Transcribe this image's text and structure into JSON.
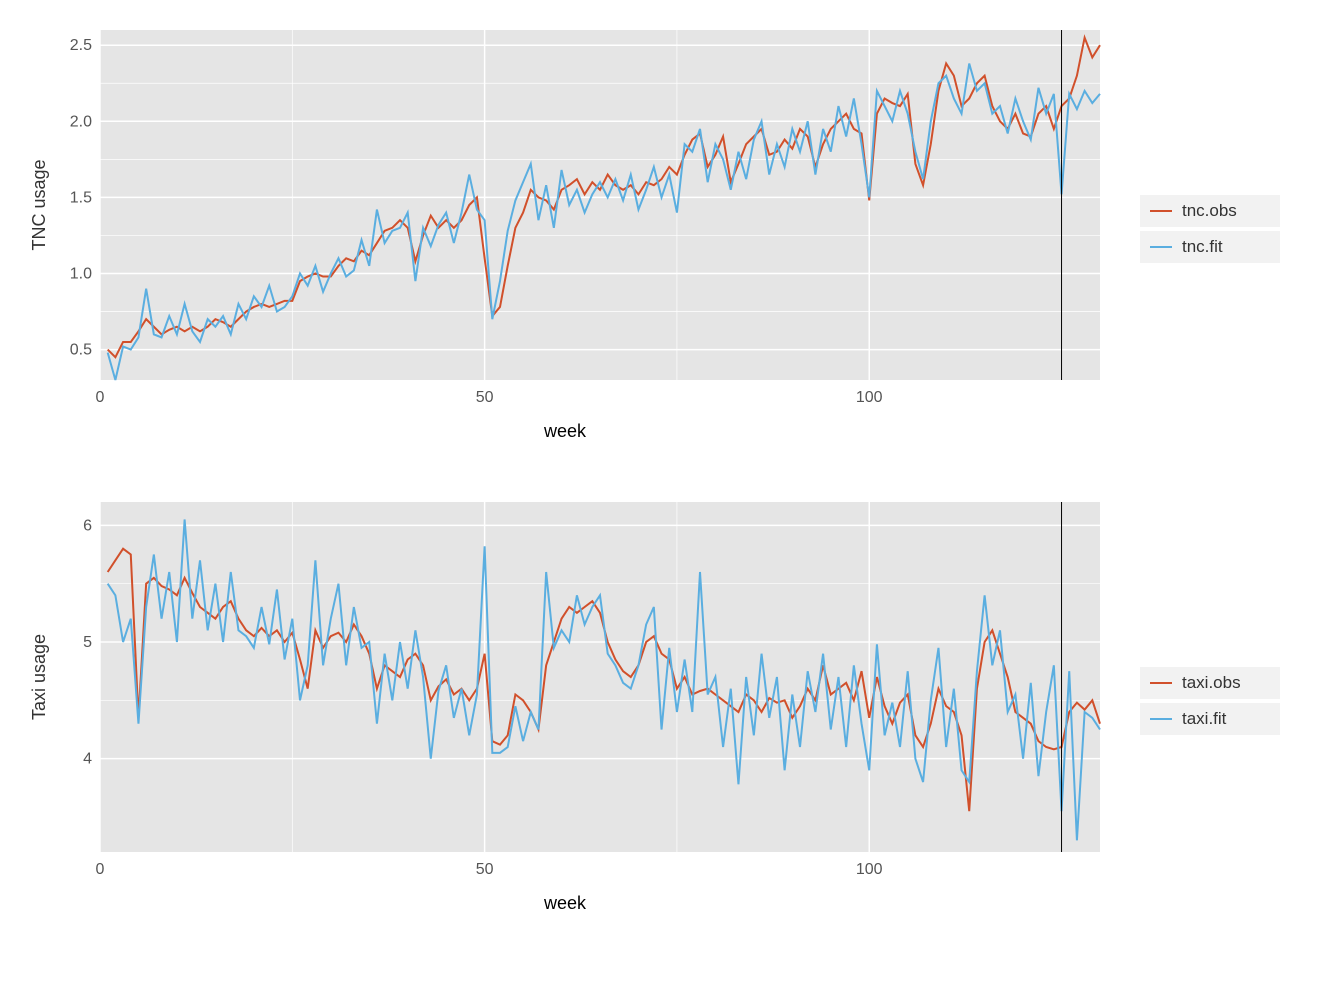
{
  "chart_data": [
    {
      "type": "line",
      "xlabel": "week",
      "ylabel": "TNC usage",
      "xlim": [
        0,
        130
      ],
      "ylim": [
        0.3,
        2.6
      ],
      "x_ticks": [
        0,
        50,
        100
      ],
      "y_ticks": [
        0.5,
        1.0,
        1.5,
        2.0,
        2.5
      ],
      "vline_x": 125,
      "series": [
        {
          "name": "tnc.obs",
          "color": "#d1502b",
          "x": [
            1,
            2,
            3,
            4,
            5,
            6,
            7,
            8,
            9,
            10,
            11,
            12,
            13,
            14,
            15,
            16,
            17,
            18,
            19,
            20,
            21,
            22,
            23,
            24,
            25,
            26,
            27,
            28,
            29,
            30,
            31,
            32,
            33,
            34,
            35,
            36,
            37,
            38,
            39,
            40,
            41,
            42,
            43,
            44,
            45,
            46,
            47,
            48,
            49,
            50,
            51,
            52,
            53,
            54,
            55,
            56,
            57,
            58,
            59,
            60,
            61,
            62,
            63,
            64,
            65,
            66,
            67,
            68,
            69,
            70,
            71,
            72,
            73,
            74,
            75,
            76,
            77,
            78,
            79,
            80,
            81,
            82,
            83,
            84,
            85,
            86,
            87,
            88,
            89,
            90,
            91,
            92,
            93,
            94,
            95,
            96,
            97,
            98,
            99,
            100,
            101,
            102,
            103,
            104,
            105,
            106,
            107,
            108,
            109,
            110,
            111,
            112,
            113,
            114,
            115,
            116,
            117,
            118,
            119,
            120,
            121,
            122,
            123,
            124,
            125,
            126,
            127,
            128,
            129,
            130
          ],
          "y": [
            0.5,
            0.45,
            0.55,
            0.55,
            0.62,
            0.7,
            0.65,
            0.6,
            0.63,
            0.65,
            0.62,
            0.65,
            0.62,
            0.65,
            0.7,
            0.68,
            0.65,
            0.7,
            0.75,
            0.78,
            0.8,
            0.78,
            0.8,
            0.82,
            0.82,
            0.95,
            0.98,
            1.0,
            0.98,
            0.98,
            1.05,
            1.1,
            1.08,
            1.15,
            1.12,
            1.2,
            1.28,
            1.3,
            1.35,
            1.3,
            1.08,
            1.25,
            1.38,
            1.3,
            1.35,
            1.3,
            1.35,
            1.45,
            1.5,
            1.1,
            0.72,
            0.78,
            1.05,
            1.3,
            1.4,
            1.55,
            1.5,
            1.48,
            1.42,
            1.55,
            1.58,
            1.62,
            1.52,
            1.6,
            1.55,
            1.65,
            1.58,
            1.55,
            1.58,
            1.52,
            1.6,
            1.58,
            1.62,
            1.7,
            1.65,
            1.78,
            1.88,
            1.92,
            1.7,
            1.78,
            1.9,
            1.6,
            1.72,
            1.85,
            1.9,
            1.95,
            1.78,
            1.8,
            1.88,
            1.82,
            1.95,
            1.9,
            1.7,
            1.85,
            1.95,
            2.0,
            2.05,
            1.95,
            1.92,
            1.48,
            2.05,
            2.15,
            2.12,
            2.1,
            2.18,
            1.72,
            1.58,
            1.85,
            2.2,
            2.38,
            2.3,
            2.1,
            2.15,
            2.25,
            2.3,
            2.1,
            2.0,
            1.95,
            2.05,
            1.92,
            1.9,
            2.05,
            2.1,
            1.95,
            2.1,
            2.15,
            2.3,
            2.55,
            2.42,
            2.5
          ]
        },
        {
          "name": "tnc.fit",
          "color": "#5aaee0",
          "x": [
            1,
            2,
            3,
            4,
            5,
            6,
            7,
            8,
            9,
            10,
            11,
            12,
            13,
            14,
            15,
            16,
            17,
            18,
            19,
            20,
            21,
            22,
            23,
            24,
            25,
            26,
            27,
            28,
            29,
            30,
            31,
            32,
            33,
            34,
            35,
            36,
            37,
            38,
            39,
            40,
            41,
            42,
            43,
            44,
            45,
            46,
            47,
            48,
            49,
            50,
            51,
            52,
            53,
            54,
            55,
            56,
            57,
            58,
            59,
            60,
            61,
            62,
            63,
            64,
            65,
            66,
            67,
            68,
            69,
            70,
            71,
            72,
            73,
            74,
            75,
            76,
            77,
            78,
            79,
            80,
            81,
            82,
            83,
            84,
            85,
            86,
            87,
            88,
            89,
            90,
            91,
            92,
            93,
            94,
            95,
            96,
            97,
            98,
            99,
            100,
            101,
            102,
            103,
            104,
            105,
            106,
            107,
            108,
            109,
            110,
            111,
            112,
            113,
            114,
            115,
            116,
            117,
            118,
            119,
            120,
            121,
            122,
            123,
            124,
            125,
            126,
            127,
            128,
            129,
            130
          ],
          "y": [
            0.48,
            0.3,
            0.52,
            0.5,
            0.58,
            0.9,
            0.6,
            0.58,
            0.72,
            0.6,
            0.8,
            0.62,
            0.55,
            0.7,
            0.65,
            0.72,
            0.6,
            0.8,
            0.7,
            0.85,
            0.78,
            0.92,
            0.75,
            0.78,
            0.85,
            1.0,
            0.92,
            1.05,
            0.88,
            1.0,
            1.1,
            0.98,
            1.02,
            1.22,
            1.05,
            1.42,
            1.2,
            1.28,
            1.3,
            1.4,
            0.95,
            1.3,
            1.18,
            1.32,
            1.4,
            1.2,
            1.4,
            1.65,
            1.42,
            1.35,
            0.7,
            0.95,
            1.28,
            1.48,
            1.6,
            1.72,
            1.35,
            1.58,
            1.3,
            1.68,
            1.45,
            1.55,
            1.4,
            1.52,
            1.6,
            1.5,
            1.62,
            1.48,
            1.65,
            1.42,
            1.55,
            1.7,
            1.5,
            1.65,
            1.4,
            1.85,
            1.8,
            1.95,
            1.6,
            1.85,
            1.75,
            1.55,
            1.8,
            1.62,
            1.88,
            2.0,
            1.65,
            1.85,
            1.7,
            1.95,
            1.8,
            2.0,
            1.65,
            1.95,
            1.8,
            2.1,
            1.9,
            2.15,
            1.85,
            1.5,
            2.2,
            2.1,
            2.0,
            2.2,
            2.05,
            1.8,
            1.62,
            2.0,
            2.25,
            2.3,
            2.15,
            2.05,
            2.38,
            2.2,
            2.25,
            2.05,
            2.1,
            1.92,
            2.15,
            2.0,
            1.88,
            2.22,
            2.05,
            2.18,
            1.52,
            2.18,
            2.08,
            2.2,
            2.12,
            2.18
          ]
        }
      ],
      "legend": [
        "tnc.obs",
        "tnc.fit"
      ]
    },
    {
      "type": "line",
      "xlabel": "week",
      "ylabel": "Taxi usage",
      "xlim": [
        0,
        130
      ],
      "ylim": [
        3.2,
        6.2
      ],
      "x_ticks": [
        0,
        50,
        100
      ],
      "y_ticks": [
        4,
        5,
        6
      ],
      "vline_x": 125,
      "series": [
        {
          "name": "taxi.obs",
          "color": "#d1502b",
          "x": [
            1,
            2,
            3,
            4,
            5,
            6,
            7,
            8,
            9,
            10,
            11,
            12,
            13,
            14,
            15,
            16,
            17,
            18,
            19,
            20,
            21,
            22,
            23,
            24,
            25,
            26,
            27,
            28,
            29,
            30,
            31,
            32,
            33,
            34,
            35,
            36,
            37,
            38,
            39,
            40,
            41,
            42,
            43,
            44,
            45,
            46,
            47,
            48,
            49,
            50,
            51,
            52,
            53,
            54,
            55,
            56,
            57,
            58,
            59,
            60,
            61,
            62,
            63,
            64,
            65,
            66,
            67,
            68,
            69,
            70,
            71,
            72,
            73,
            74,
            75,
            76,
            77,
            78,
            79,
            80,
            81,
            82,
            83,
            84,
            85,
            86,
            87,
            88,
            89,
            90,
            91,
            92,
            93,
            94,
            95,
            96,
            97,
            98,
            99,
            100,
            101,
            102,
            103,
            104,
            105,
            106,
            107,
            108,
            109,
            110,
            111,
            112,
            113,
            114,
            115,
            116,
            117,
            118,
            119,
            120,
            121,
            122,
            123,
            124,
            125,
            126,
            127,
            128,
            129,
            130
          ],
          "y": [
            5.6,
            5.7,
            5.8,
            5.75,
            4.35,
            5.5,
            5.55,
            5.48,
            5.45,
            5.4,
            5.55,
            5.42,
            5.3,
            5.25,
            5.2,
            5.3,
            5.35,
            5.2,
            5.1,
            5.05,
            5.12,
            5.05,
            5.1,
            5.0,
            5.08,
            4.85,
            4.6,
            5.1,
            4.95,
            5.05,
            5.08,
            5.0,
            5.15,
            5.05,
            4.9,
            4.6,
            4.8,
            4.75,
            4.7,
            4.85,
            4.9,
            4.8,
            4.5,
            4.62,
            4.68,
            4.55,
            4.6,
            4.5,
            4.6,
            4.9,
            4.15,
            4.12,
            4.2,
            4.55,
            4.5,
            4.4,
            4.25,
            4.8,
            5.0,
            5.2,
            5.3,
            5.25,
            5.3,
            5.35,
            5.25,
            5.0,
            4.85,
            4.75,
            4.7,
            4.8,
            5.0,
            5.05,
            4.9,
            4.85,
            4.6,
            4.7,
            4.55,
            4.58,
            4.6,
            4.55,
            4.5,
            4.45,
            4.4,
            4.55,
            4.5,
            4.4,
            4.52,
            4.48,
            4.5,
            4.35,
            4.45,
            4.6,
            4.5,
            4.8,
            4.55,
            4.6,
            4.65,
            4.5,
            4.75,
            4.35,
            4.7,
            4.45,
            4.3,
            4.48,
            4.55,
            4.2,
            4.1,
            4.3,
            4.6,
            4.45,
            4.4,
            4.2,
            3.55,
            4.6,
            5.0,
            5.1,
            4.9,
            4.7,
            4.4,
            4.35,
            4.3,
            4.15,
            4.1,
            4.08,
            4.1,
            4.4,
            4.48,
            4.42,
            4.5,
            4.3
          ]
        },
        {
          "name": "taxi.fit",
          "color": "#5aaee0",
          "x": [
            1,
            2,
            3,
            4,
            5,
            6,
            7,
            8,
            9,
            10,
            11,
            12,
            13,
            14,
            15,
            16,
            17,
            18,
            19,
            20,
            21,
            22,
            23,
            24,
            25,
            26,
            27,
            28,
            29,
            30,
            31,
            32,
            33,
            34,
            35,
            36,
            37,
            38,
            39,
            40,
            41,
            42,
            43,
            44,
            45,
            46,
            47,
            48,
            49,
            50,
            51,
            52,
            53,
            54,
            55,
            56,
            57,
            58,
            59,
            60,
            61,
            62,
            63,
            64,
            65,
            66,
            67,
            68,
            69,
            70,
            71,
            72,
            73,
            74,
            75,
            76,
            77,
            78,
            79,
            80,
            81,
            82,
            83,
            84,
            85,
            86,
            87,
            88,
            89,
            90,
            91,
            92,
            93,
            94,
            95,
            96,
            97,
            98,
            99,
            100,
            101,
            102,
            103,
            104,
            105,
            106,
            107,
            108,
            109,
            110,
            111,
            112,
            113,
            114,
            115,
            116,
            117,
            118,
            119,
            120,
            121,
            122,
            123,
            124,
            125,
            126,
            127,
            128,
            129,
            130
          ],
          "y": [
            5.5,
            5.4,
            5.0,
            5.2,
            4.3,
            5.3,
            5.75,
            5.2,
            5.6,
            5.0,
            6.05,
            5.2,
            5.7,
            5.1,
            5.5,
            5.0,
            5.6,
            5.1,
            5.05,
            4.95,
            5.3,
            4.98,
            5.45,
            4.85,
            5.2,
            4.5,
            4.8,
            5.7,
            4.8,
            5.2,
            5.5,
            4.8,
            5.3,
            4.95,
            5.0,
            4.3,
            4.9,
            4.5,
            5.0,
            4.6,
            5.1,
            4.7,
            4.0,
            4.58,
            4.8,
            4.35,
            4.6,
            4.2,
            4.55,
            5.82,
            4.05,
            4.05,
            4.1,
            4.45,
            4.15,
            4.4,
            4.25,
            5.6,
            4.95,
            5.1,
            5.0,
            5.4,
            5.15,
            5.3,
            5.4,
            4.9,
            4.8,
            4.65,
            4.6,
            4.8,
            5.15,
            5.3,
            4.25,
            4.95,
            4.4,
            4.85,
            4.4,
            5.6,
            4.55,
            4.7,
            4.1,
            4.6,
            3.78,
            4.7,
            4.2,
            4.9,
            4.35,
            4.7,
            3.9,
            4.55,
            4.1,
            4.75,
            4.4,
            4.9,
            4.25,
            4.7,
            4.1,
            4.8,
            4.3,
            3.9,
            4.98,
            4.2,
            4.48,
            4.1,
            4.75,
            4.0,
            3.8,
            4.5,
            4.95,
            4.1,
            4.6,
            3.9,
            3.8,
            4.75,
            5.4,
            4.8,
            5.1,
            4.4,
            4.55,
            4.0,
            4.65,
            3.85,
            4.4,
            4.8,
            3.55,
            4.75,
            3.3,
            4.4,
            4.35,
            4.25
          ]
        }
      ],
      "legend": [
        "taxi.obs",
        "taxi.fit"
      ]
    }
  ]
}
